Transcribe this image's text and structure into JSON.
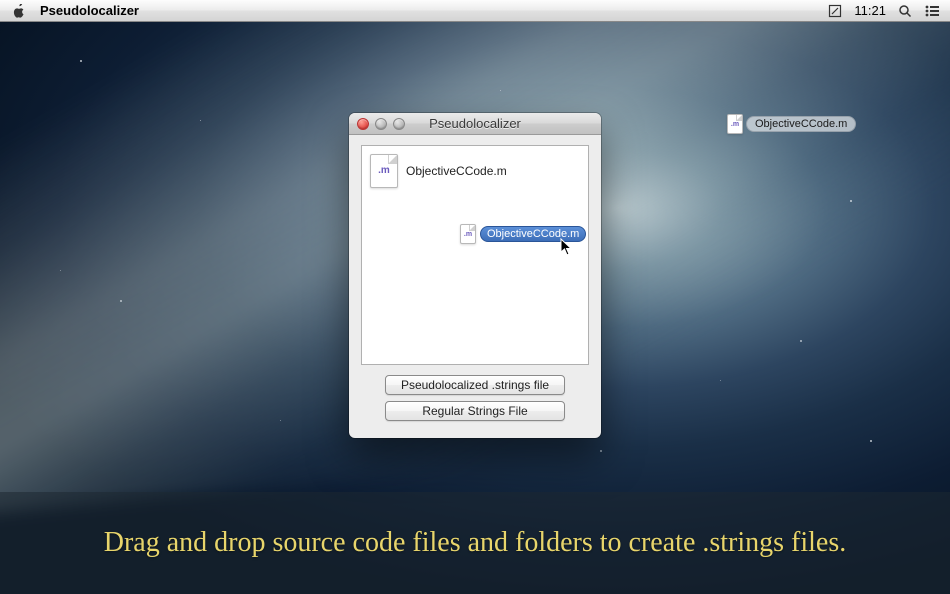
{
  "menubar": {
    "app_name": "Pseudolocalizer",
    "time": "11:21"
  },
  "window": {
    "title": "Pseudolocalizer",
    "file_in_list": "ObjectiveCCode.m",
    "dragged_file": "ObjectiveCCode.m",
    "buttons": {
      "pseudo": "Pseudolocalized .strings file",
      "regular": "Regular Strings File"
    }
  },
  "desktop_icon": {
    "label": "ObjectiveCCode.m"
  },
  "caption": {
    "text": "Drag and drop source code files and folders to create .strings files."
  }
}
